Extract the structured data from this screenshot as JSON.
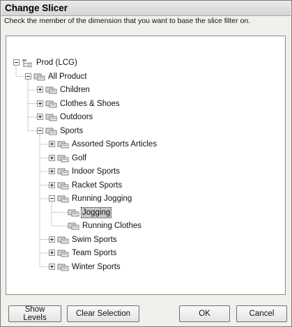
{
  "window": {
    "title": "Change Slicer"
  },
  "instructions": "Check the member of the dimension that you want to base the slice filter on.",
  "tree": [
    {
      "label": "Prod (LCG)",
      "level": 0,
      "expander": "minus",
      "icon": "hierarchy-icon"
    },
    {
      "label": "All Product",
      "level": 1,
      "expander": "minus",
      "icon": "member-icon"
    },
    {
      "label": "Children",
      "level": 2,
      "expander": "plus",
      "icon": "member-icon"
    },
    {
      "label": "Clothes & Shoes",
      "level": 2,
      "expander": "plus",
      "icon": "member-icon"
    },
    {
      "label": "Outdoors",
      "level": 2,
      "expander": "plus",
      "icon": "member-icon"
    },
    {
      "label": "Sports",
      "level": 2,
      "expander": "minus",
      "icon": "member-icon"
    },
    {
      "label": "Assorted Sports Articles",
      "level": 3,
      "expander": "plus",
      "icon": "member-icon"
    },
    {
      "label": "Golf",
      "level": 3,
      "expander": "plus",
      "icon": "member-icon"
    },
    {
      "label": "Indoor Sports",
      "level": 3,
      "expander": "plus",
      "icon": "member-icon"
    },
    {
      "label": "Racket Sports",
      "level": 3,
      "expander": "plus",
      "icon": "member-icon"
    },
    {
      "label": "Running Jogging",
      "level": 3,
      "expander": "minus",
      "icon": "member-icon"
    },
    {
      "label": "Jogging",
      "level": 4,
      "expander": "none",
      "icon": "member-icon",
      "selected": true
    },
    {
      "label": "Running Clothes",
      "level": 4,
      "expander": "none",
      "icon": "member-icon"
    },
    {
      "label": "Swim Sports",
      "level": 3,
      "expander": "plus",
      "icon": "member-icon"
    },
    {
      "label": "Team Sports",
      "level": 3,
      "expander": "plus",
      "icon": "member-icon"
    },
    {
      "label": "Winter Sports",
      "level": 3,
      "expander": "plus",
      "icon": "member-icon"
    }
  ],
  "buttons": {
    "show_levels": "Show Levels",
    "clear_selection": "Clear Selection",
    "ok": "OK",
    "cancel": "Cancel"
  },
  "colors": {
    "dialog_background": "#f0f0ec",
    "selection_highlight": "#c8c8c8",
    "tree_lines": "#a0a0a0"
  }
}
